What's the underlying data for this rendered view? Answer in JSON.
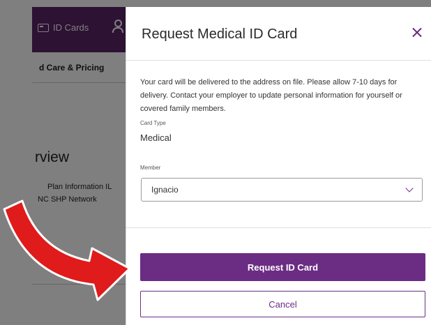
{
  "background": {
    "header_link": "ID Cards",
    "nav_item": "d Care & Pricing",
    "overview_heading": "rview",
    "plan_line1": "Plan Information IL",
    "plan_line2": "NC SHP Network"
  },
  "modal": {
    "title": "Request Medical ID Card",
    "info_text": "Your card will be delivered to the address on file. Please allow 7-10 days for delivery. Contact your employer to update personal information for yourself or covered family members.",
    "card_type_label": "Card Type",
    "card_type_value": "Medical",
    "member_label": "Member",
    "member_selected": "Ignacio",
    "request_button": "Request ID Card",
    "cancel_button": "Cancel"
  },
  "colors": {
    "brand_purple": "#6b2d84",
    "header_purple": "#5b2468",
    "arrow_red": "#e01b1b"
  },
  "icons": {
    "card": "id-card-icon",
    "person": "person-icon",
    "close": "close-icon",
    "dropdown": "chevron-down-icon",
    "annotation": "red-arrow-icon"
  }
}
